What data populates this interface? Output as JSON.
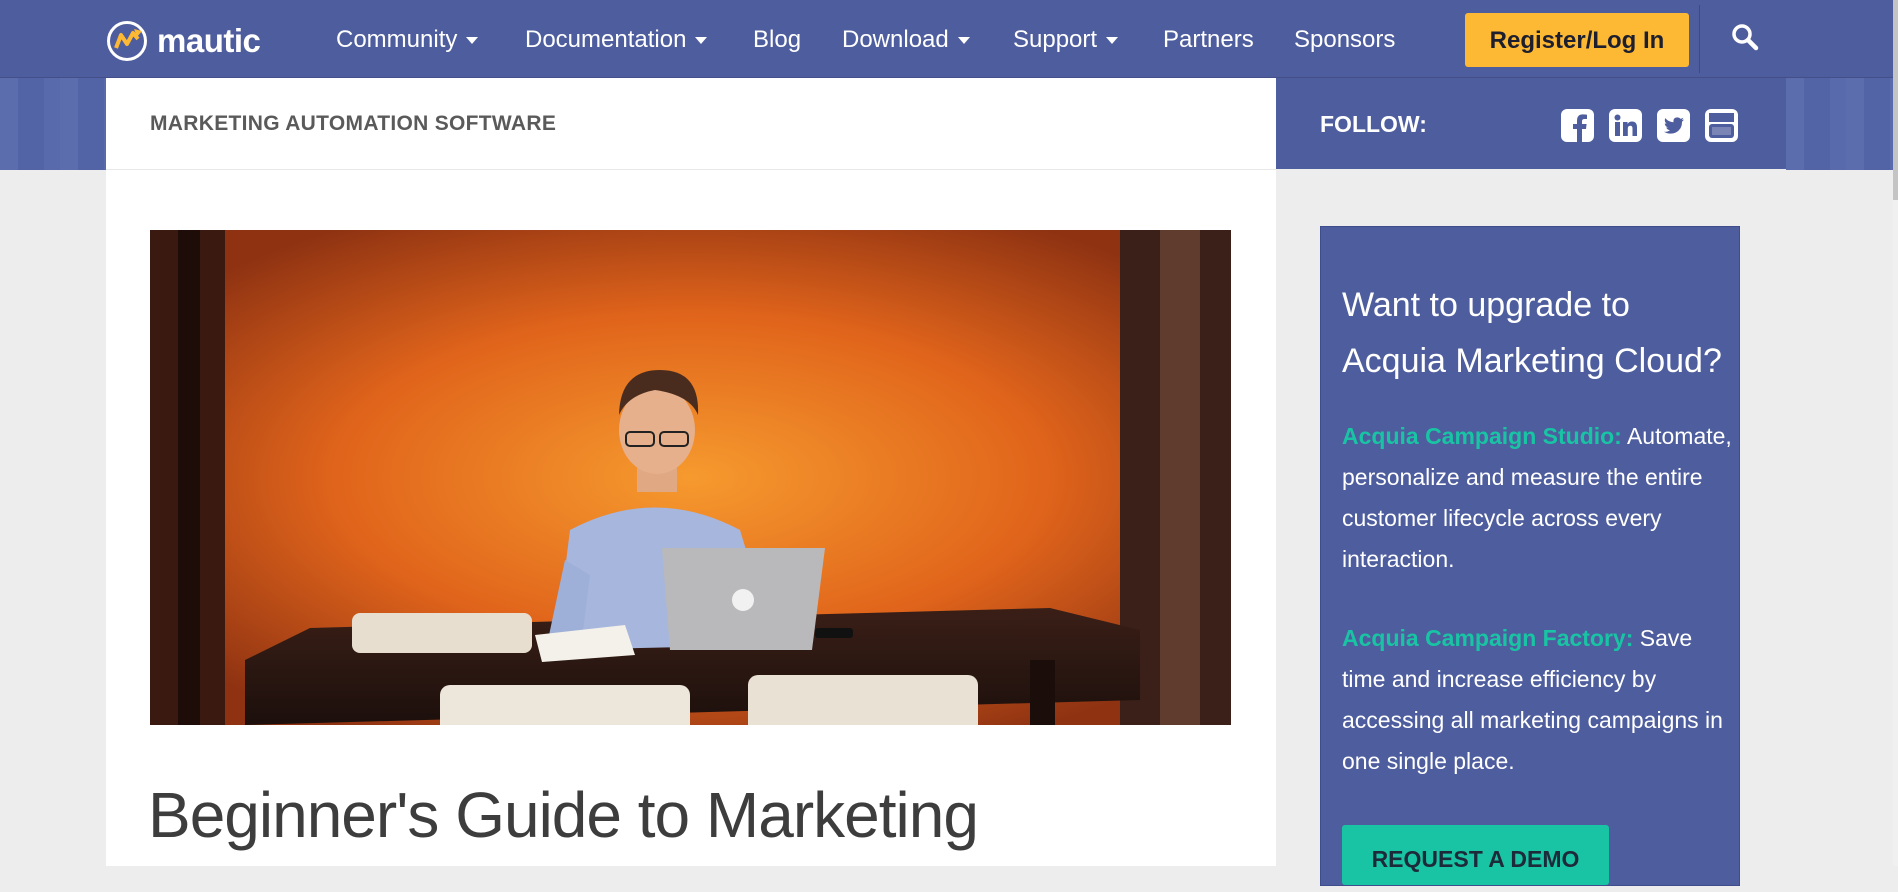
{
  "header": {
    "brand": "mautic",
    "nav": [
      {
        "label": "Community",
        "dropdown": true
      },
      {
        "label": "Documentation",
        "dropdown": true
      },
      {
        "label": "Blog",
        "dropdown": false
      },
      {
        "label": "Download",
        "dropdown": true
      },
      {
        "label": "Support",
        "dropdown": true
      },
      {
        "label": "Partners",
        "dropdown": false
      },
      {
        "label": "Sponsors",
        "dropdown": false
      }
    ],
    "register_label": "Register/Log In",
    "icons": [
      "mautic-logo-icon",
      "search-icon"
    ]
  },
  "breadcrumb": "MARKETING AUTOMATION SOFTWARE",
  "follow": {
    "label": "FOLLOW:",
    "icons": [
      "facebook-icon",
      "linkedin-icon",
      "twitter-icon",
      "youtube-icon"
    ]
  },
  "article": {
    "hero_image": "man-working-on-laptop-orange-wall-photo",
    "title": "Beginner's Guide to Marketing"
  },
  "promo": {
    "heading": "Want to upgrade to Acquia Marketing Cloud?",
    "items": [
      {
        "name": "Acquia Campaign Studio:",
        "text": "Automate, personalize and measure the entire customer lifecycle across every interaction."
      },
      {
        "name": "Acquia Campaign Factory:",
        "text": "Save time and increase efficiency by accessing all marketing campaigns in one single place."
      }
    ],
    "cta": "REQUEST A DEMO"
  },
  "colors": {
    "nav_bg": "#4e5d9d",
    "accent_yellow": "#fdb933",
    "accent_teal": "#19c4a4"
  }
}
